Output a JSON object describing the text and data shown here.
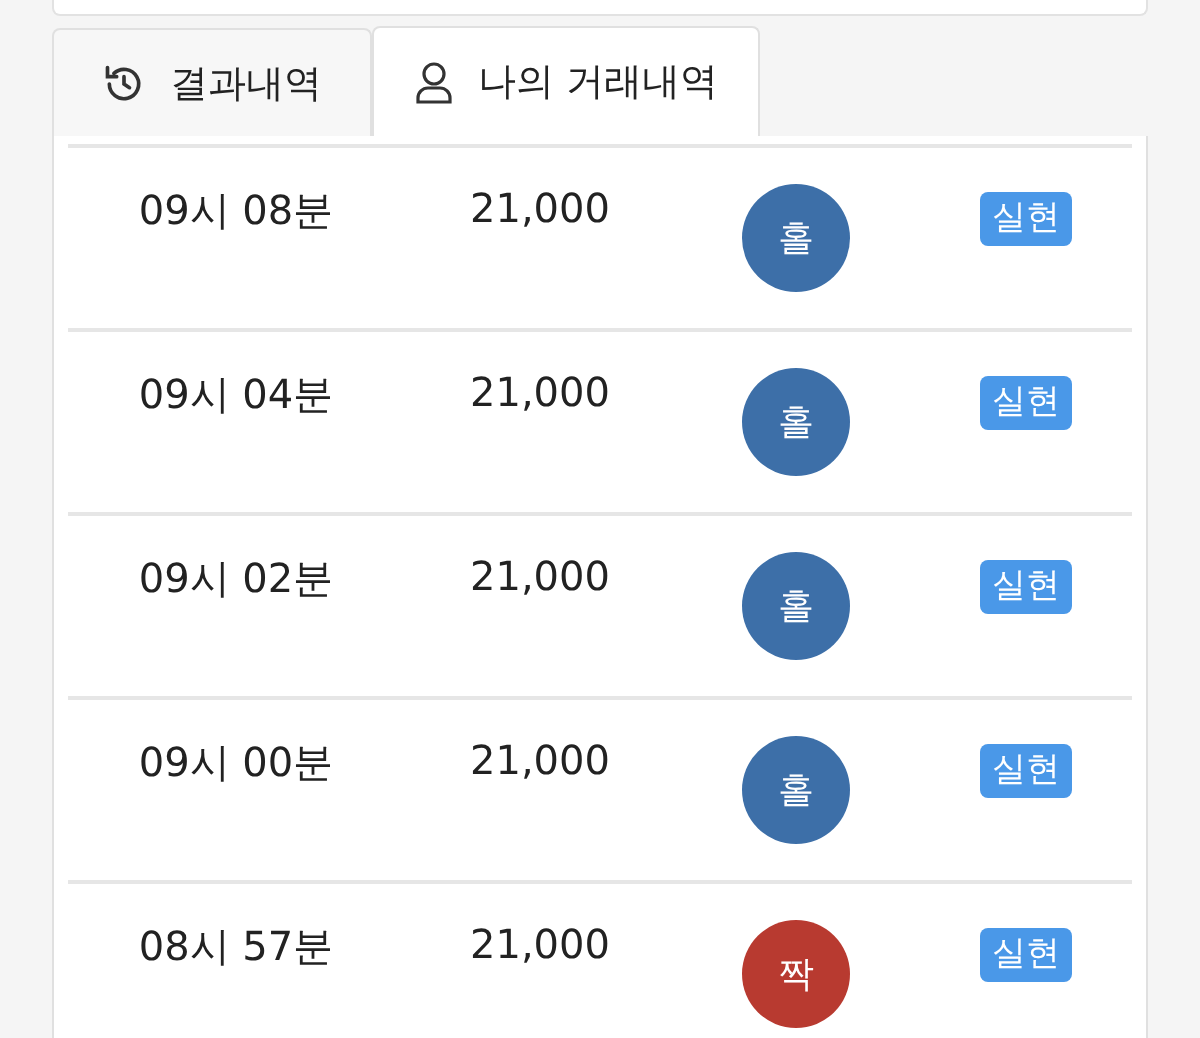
{
  "tabs": [
    {
      "label": "결과내역",
      "kind": "history",
      "selected": false
    },
    {
      "label": "나의 거래내역",
      "kind": "user",
      "selected": true
    }
  ],
  "rows": [
    {
      "time": "09시 08분",
      "amount": "21,000",
      "result": "홀",
      "color": "#3d6fa8",
      "status": "실현"
    },
    {
      "time": "09시 04분",
      "amount": "21,000",
      "result": "홀",
      "color": "#3d6fa8",
      "status": "실현"
    },
    {
      "time": "09시 02분",
      "amount": "21,000",
      "result": "홀",
      "color": "#3d6fa8",
      "status": "실현"
    },
    {
      "time": "09시 00분",
      "amount": "21,000",
      "result": "홀",
      "color": "#3d6fa8",
      "status": "실현"
    },
    {
      "time": "08시 57분",
      "amount": "21,000",
      "result": "짝",
      "color": "#b83a30",
      "status": "실현"
    }
  ]
}
